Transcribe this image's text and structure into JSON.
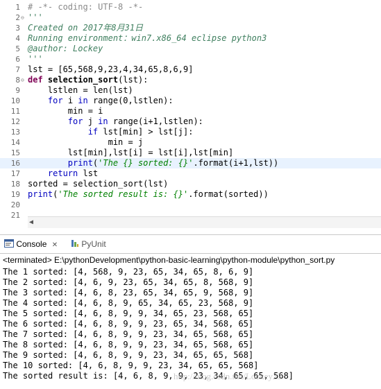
{
  "editor": {
    "lines": [
      {
        "n": "1",
        "fold": "",
        "html": [
          {
            "c": "cm",
            "t": "# -*- coding: UTF-8 -*-"
          }
        ]
      },
      {
        "n": "2",
        "fold": "⊖",
        "html": [
          {
            "c": "cmi",
            "t": "'''"
          }
        ]
      },
      {
        "n": "3",
        "fold": "",
        "html": [
          {
            "c": "cmi",
            "t": "Created on 2017年8月31日"
          }
        ]
      },
      {
        "n": "4",
        "fold": "",
        "html": [
          {
            "c": "cmi",
            "t": "Running environment：win7.x86_64 eclipse python3"
          }
        ]
      },
      {
        "n": "5",
        "fold": "",
        "html": [
          {
            "c": "cmi",
            "t": "@author: Lockey"
          }
        ]
      },
      {
        "n": "6",
        "fold": "",
        "html": [
          {
            "c": "cmi",
            "t": "'''"
          }
        ]
      },
      {
        "n": "7",
        "fold": "",
        "html": [
          {
            "c": "",
            "t": "lst = [65,568,9,23,4,34,65,8,6,9]"
          }
        ]
      },
      {
        "n": "8",
        "fold": "⊖",
        "html": [
          {
            "c": "kw",
            "t": "def "
          },
          {
            "c": "fn",
            "t": "selection_sort"
          },
          {
            "c": "",
            "t": "(lst):"
          }
        ]
      },
      {
        "n": "9",
        "fold": "",
        "html": [
          {
            "c": "",
            "t": "    lstlen = len(lst)"
          }
        ]
      },
      {
        "n": "10",
        "fold": "",
        "html": [
          {
            "c": "",
            "t": "    "
          },
          {
            "c": "kwb",
            "t": "for"
          },
          {
            "c": "",
            "t": " i "
          },
          {
            "c": "kwb",
            "t": "in"
          },
          {
            "c": "",
            "t": " range(0,lstlen):"
          }
        ]
      },
      {
        "n": "11",
        "fold": "",
        "html": [
          {
            "c": "",
            "t": "        min = i"
          }
        ]
      },
      {
        "n": "12",
        "fold": "",
        "html": [
          {
            "c": "",
            "t": "        "
          },
          {
            "c": "kwb",
            "t": "for"
          },
          {
            "c": "",
            "t": " j "
          },
          {
            "c": "kwb",
            "t": "in"
          },
          {
            "c": "",
            "t": " range(i+1,lstlen):"
          }
        ]
      },
      {
        "n": "13",
        "fold": "",
        "html": [
          {
            "c": "",
            "t": "            "
          },
          {
            "c": "kwb",
            "t": "if"
          },
          {
            "c": "",
            "t": " lst[min] > lst[j]:"
          }
        ]
      },
      {
        "n": "14",
        "fold": "",
        "html": [
          {
            "c": "",
            "t": "                min = j"
          }
        ]
      },
      {
        "n": "15",
        "fold": "",
        "html": [
          {
            "c": "",
            "t": "        lst[min],lst[i] = lst[i],lst[min]"
          }
        ]
      },
      {
        "n": "16",
        "fold": "",
        "current": true,
        "html": [
          {
            "c": "",
            "t": "        "
          },
          {
            "c": "kwb",
            "t": "print"
          },
          {
            "c": "",
            "t": "("
          },
          {
            "c": "st",
            "t": "'The {} sorted: {}'"
          },
          {
            "c": "",
            "t": ".format(i+1,lst))"
          }
        ]
      },
      {
        "n": "17",
        "fold": "",
        "html": [
          {
            "c": "",
            "t": "    "
          },
          {
            "c": "kwb",
            "t": "return"
          },
          {
            "c": "",
            "t": " lst"
          }
        ]
      },
      {
        "n": "18",
        "fold": "",
        "html": [
          {
            "c": "",
            "t": "sorted = selection_sort(lst)"
          }
        ]
      },
      {
        "n": "19",
        "fold": "",
        "html": [
          {
            "c": "kwb",
            "t": "print"
          },
          {
            "c": "",
            "t": "("
          },
          {
            "c": "st",
            "t": "'The sorted result is: {}'"
          },
          {
            "c": "",
            "t": ".format(sorted))"
          }
        ]
      },
      {
        "n": "20",
        "fold": "",
        "html": []
      },
      {
        "n": "21",
        "fold": "",
        "html": []
      }
    ],
    "scroll_arrow": "◀"
  },
  "console": {
    "tab_console": "Console",
    "tab_close": "✕",
    "tab_pyunit": "PyUnit",
    "status": "<terminated> E:\\pythonDevelopment\\python-basic-learning\\python-module\\python_sort.py",
    "output": [
      "The 1 sorted: [4, 568, 9, 23, 65, 34, 65, 8, 6, 9]",
      "The 2 sorted: [4, 6, 9, 23, 65, 34, 65, 8, 568, 9]",
      "The 3 sorted: [4, 6, 8, 23, 65, 34, 65, 9, 568, 9]",
      "The 4 sorted: [4, 6, 8, 9, 65, 34, 65, 23, 568, 9]",
      "The 5 sorted: [4, 6, 8, 9, 9, 34, 65, 23, 568, 65]",
      "The 6 sorted: [4, 6, 8, 9, 9, 23, 65, 34, 568, 65]",
      "The 7 sorted: [4, 6, 8, 9, 9, 23, 34, 65, 568, 65]",
      "The 8 sorted: [4, 6, 8, 9, 9, 23, 34, 65, 568, 65]",
      "The 9 sorted: [4, 6, 8, 9, 9, 23, 34, 65, 65, 568]",
      "The 10 sorted: [4, 6, 8, 9, 9, 23, 34, 65, 65, 568]",
      "The sorted result is: [4, 6, 8, 9, 9, 23, 34, 65, 65, 568]"
    ],
    "watermark": "http://blog.csdn.net/Lockey23"
  }
}
